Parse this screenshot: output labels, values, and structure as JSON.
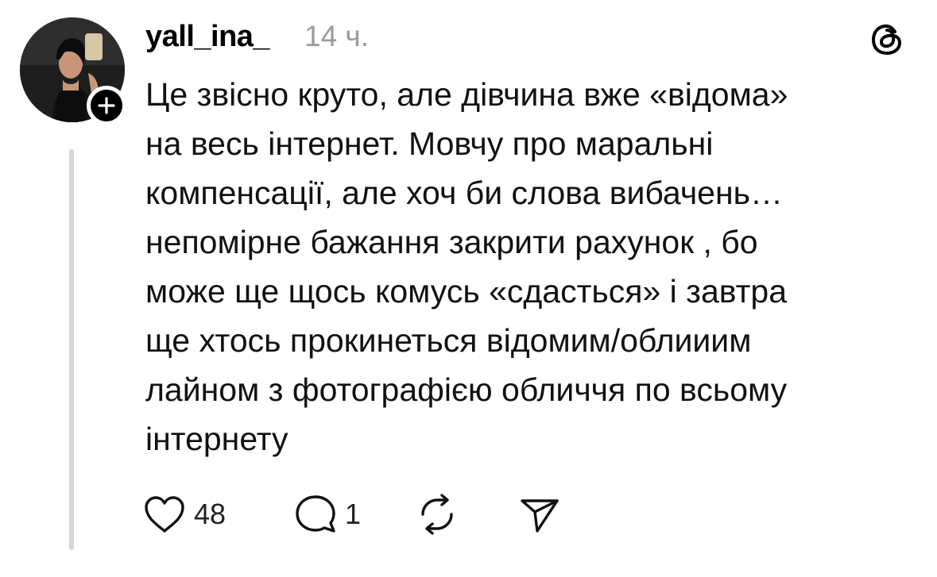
{
  "post": {
    "username": "yall_ina_",
    "timestamp": "14 ч.",
    "text_lines": [
      "Це звісно круто, але дівчина вже «відома»",
      "на весь інтернет. Мовчу про маральні",
      "компенсації, але хоч би слова вибачень…",
      "непомірне бажання закрити рахунок , бо",
      "може ще щось комусь «сдасться» і завтра",
      "ще хтось прокинеться відомим/облииим",
      "лайном з фотографією обличчя по всьому",
      "інтернету"
    ],
    "actions": {
      "likes": "48",
      "replies": "1"
    }
  },
  "icons": {
    "platform": "threads-logo-icon",
    "follow": "plus-icon",
    "like": "heart-icon",
    "reply": "comment-icon",
    "repost": "repost-icon",
    "share": "share-icon"
  }
}
